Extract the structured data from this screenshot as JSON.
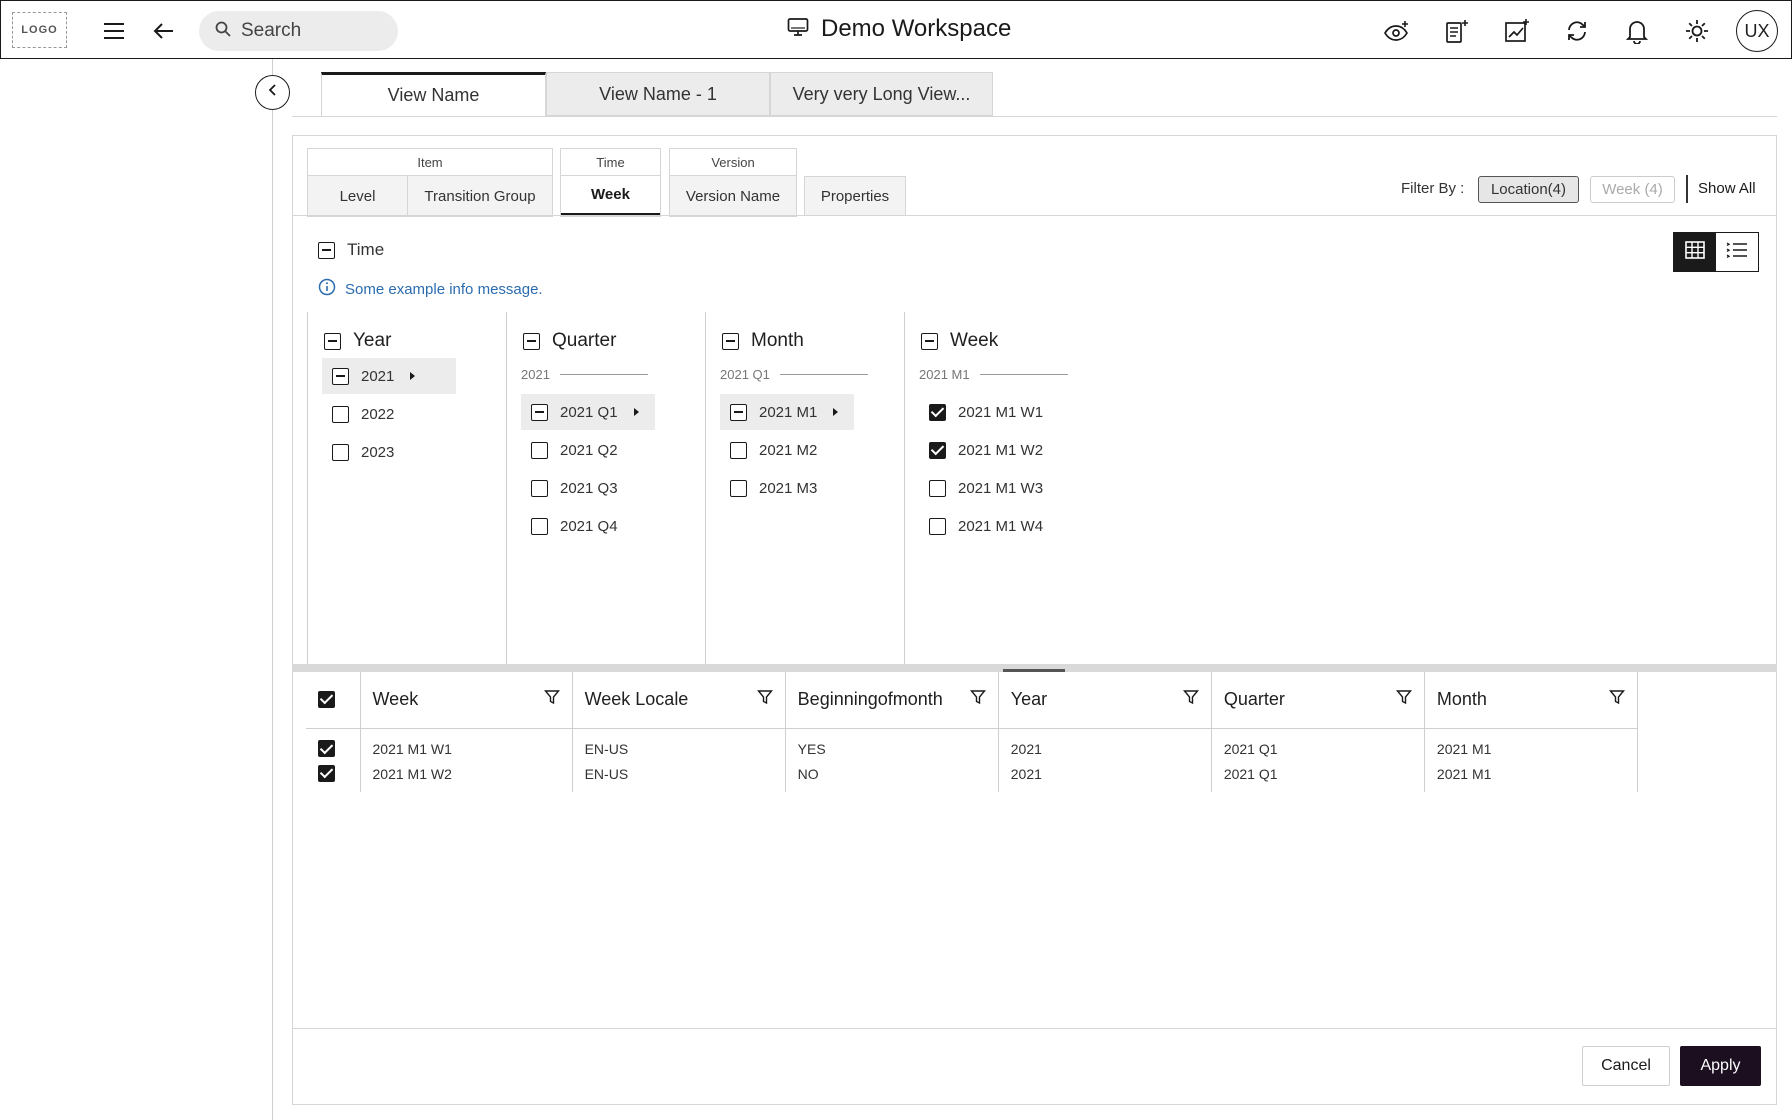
{
  "header": {
    "logo": "LOGO",
    "search_placeholder": "Search",
    "title": "Demo Workspace",
    "avatar": "UX"
  },
  "view_tabs": [
    {
      "label": "View Name",
      "active": true
    },
    {
      "label": "View Name - 1",
      "active": false
    },
    {
      "label": "Very very Long View...",
      "active": false
    }
  ],
  "dimension_groups": [
    {
      "group": "Item",
      "tabs": [
        "Level",
        "Transition Group"
      ]
    },
    {
      "group": "Time",
      "tabs": [
        "Week"
      ],
      "active": "Week"
    },
    {
      "group": "Version",
      "tabs": [
        "Version Name"
      ]
    }
  ],
  "properties_tab": "Properties",
  "filter": {
    "label": "Filter By :",
    "chips": [
      {
        "label": "Location(4)",
        "enabled": true
      },
      {
        "label": "Week (4)",
        "enabled": false
      }
    ],
    "show_all": "Show All"
  },
  "time_section": {
    "label": "Time",
    "info": "Some example info message."
  },
  "columns": [
    {
      "title": "Year",
      "sub": "",
      "items": [
        {
          "label": "2021",
          "state": "partial",
          "selected": true
        },
        {
          "label": "2022",
          "state": "none"
        },
        {
          "label": "2023",
          "state": "none"
        }
      ]
    },
    {
      "title": "Quarter",
      "sub": "2021",
      "items": [
        {
          "label": "2021 Q1",
          "state": "partial",
          "selected": true
        },
        {
          "label": "2021 Q2",
          "state": "none"
        },
        {
          "label": "2021 Q3",
          "state": "none"
        },
        {
          "label": "2021 Q4",
          "state": "none"
        }
      ]
    },
    {
      "title": "Month",
      "sub": "2021 Q1",
      "items": [
        {
          "label": "2021 M1",
          "state": "partial",
          "selected": true
        },
        {
          "label": "2021 M2",
          "state": "none"
        },
        {
          "label": "2021 M3",
          "state": "none"
        }
      ]
    },
    {
      "title": "Week",
      "sub": "2021 M1",
      "items": [
        {
          "label": "2021 M1 W1",
          "state": "checked"
        },
        {
          "label": "2021 M1 W2",
          "state": "checked"
        },
        {
          "label": "2021 M1 W3",
          "state": "none"
        },
        {
          "label": "2021 M1 W4",
          "state": "none"
        }
      ]
    }
  ],
  "table": {
    "headers": [
      "Week",
      "Week Locale",
      "Beginningofmonth",
      "Year",
      "Quarter",
      "Month"
    ],
    "rows": [
      [
        "2021 M1 W1",
        "EN-US",
        "YES",
        "2021",
        "2021 Q1",
        "2021 M1"
      ],
      [
        "2021 M1 W2",
        "EN-US",
        "NO",
        "2021",
        "2021 Q1",
        "2021 M1"
      ]
    ]
  },
  "footer": {
    "cancel": "Cancel",
    "apply": "Apply"
  }
}
